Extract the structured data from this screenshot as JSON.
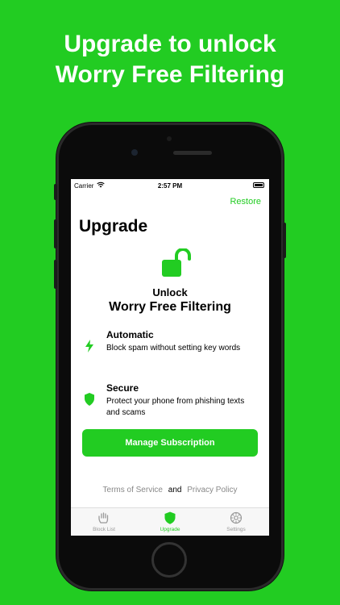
{
  "headline": {
    "line1": "Upgrade to unlock",
    "line2": "Worry Free Filtering"
  },
  "status_bar": {
    "carrier": "Carrier",
    "time": "2:57 PM"
  },
  "nav": {
    "restore_label": "Restore",
    "title": "Upgrade"
  },
  "hero": {
    "icon": "unlocked-padlock-icon",
    "label": "Unlock",
    "title": "Worry Free Filtering"
  },
  "features": [
    {
      "icon": "lightning-bolt-icon",
      "name": "Automatic",
      "description": "Block spam without setting key words"
    },
    {
      "icon": "shield-icon",
      "name": "Secure",
      "description": "Protect your phone from phishing texts and scams"
    }
  ],
  "manage_button_label": "Manage Subscription",
  "legal": {
    "terms": "Terms of Service",
    "and": "and",
    "privacy": "Privacy Policy"
  },
  "tabs": [
    {
      "icon": "hand-icon",
      "label": "Block List",
      "active": false
    },
    {
      "icon": "shield-icon",
      "label": "Upgrade",
      "active": true
    },
    {
      "icon": "gear-icon",
      "label": "Settings",
      "active": false
    }
  ],
  "colors": {
    "accent": "#22cc22",
    "background": "#22cc22",
    "inactive": "#999999"
  }
}
